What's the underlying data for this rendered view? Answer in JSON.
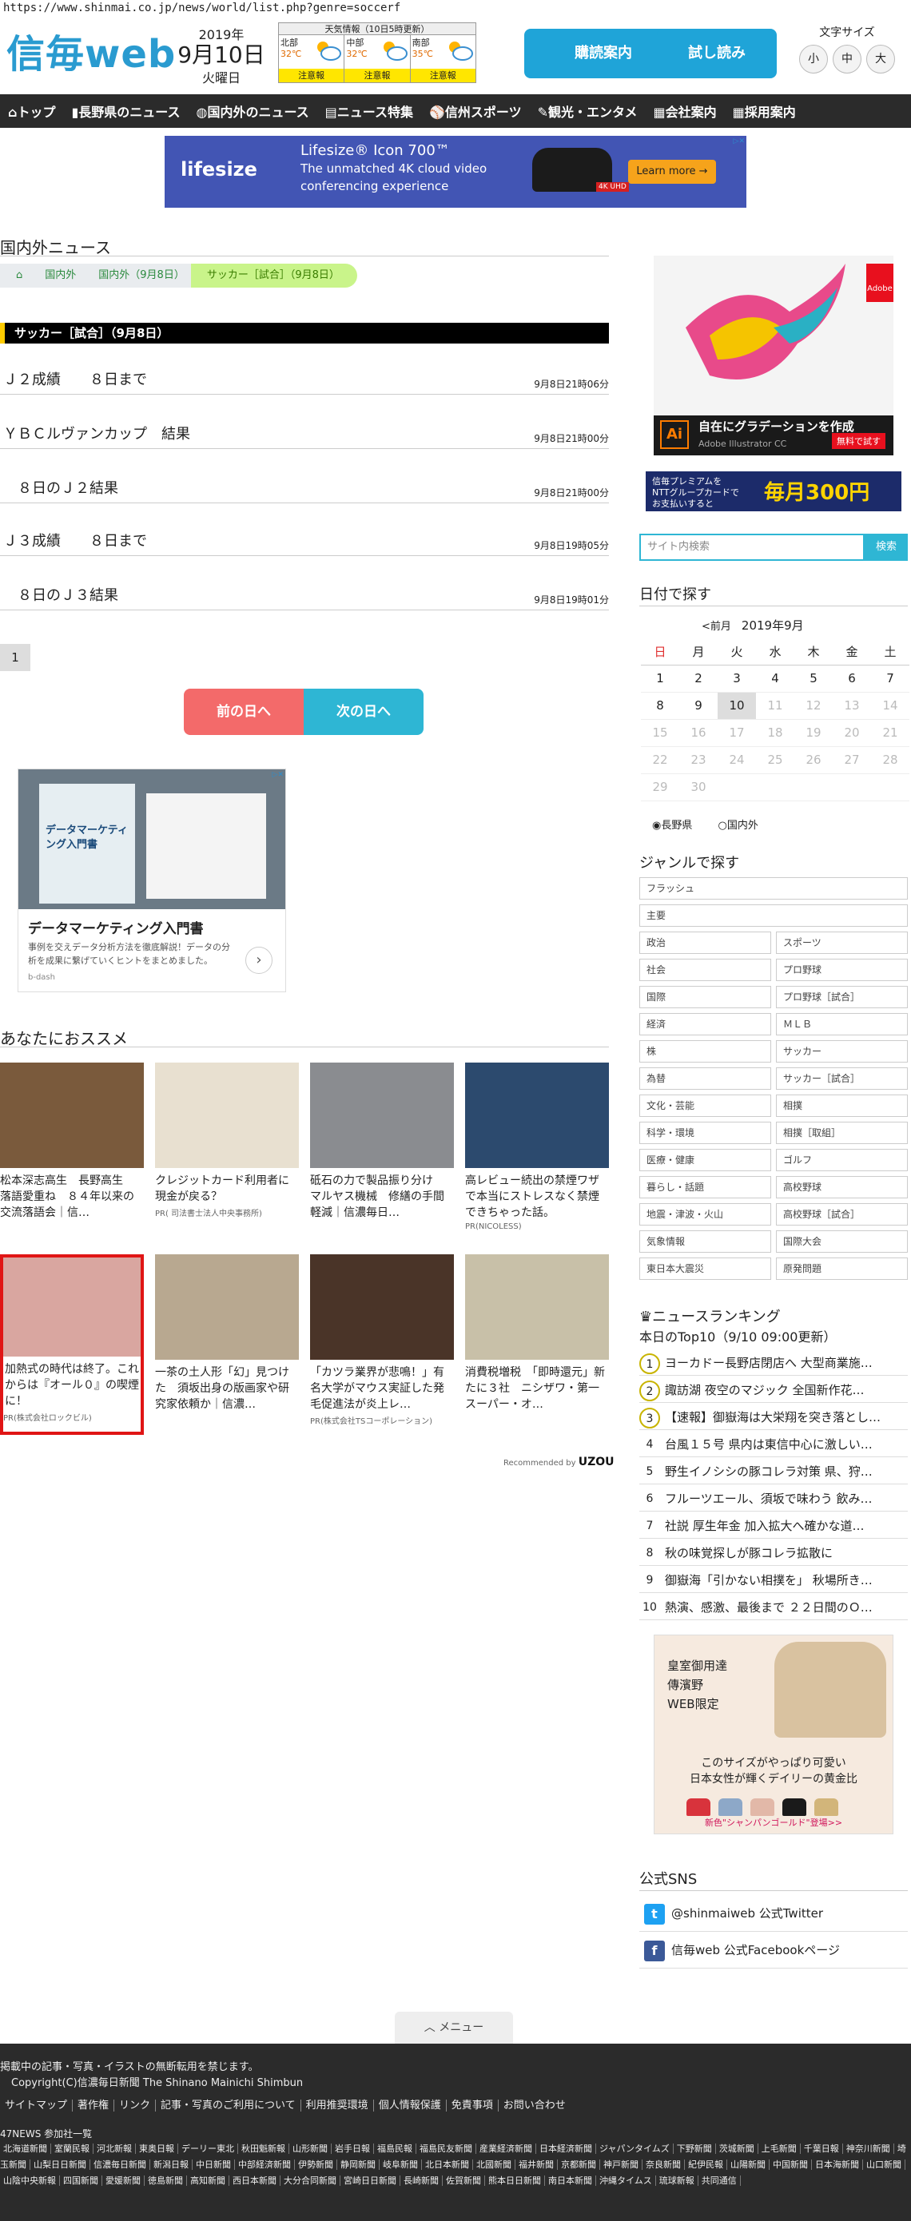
{
  "url": "https://www.shinmai.co.jp/news/world/list.php?genre=soccerf",
  "logo": "信毎web",
  "date": {
    "year": "2019年",
    "day": "9月10日",
    "weekday": "火曜日"
  },
  "weather": {
    "title": "天気情報（10日5時更新）",
    "regions": [
      {
        "name": "北部",
        "temp": "32℃",
        "warn": "注意報"
      },
      {
        "name": "中部",
        "temp": "32℃",
        "warn": "注意報"
      },
      {
        "name": "南部",
        "temp": "35℃",
        "warn": "注意報"
      }
    ]
  },
  "header_buttons": {
    "subscribe": "購読案内",
    "trial": "試し読み"
  },
  "font_size": {
    "label": "文字サイズ",
    "small": "小",
    "medium": "中",
    "large": "大"
  },
  "nav": [
    "トップ",
    "長野県のニュース",
    "国内外のニュース",
    "ニュース特集",
    "信州スポーツ",
    "観光・エンタメ",
    "会社案内",
    "採用案内"
  ],
  "top_ad": {
    "brand": "lifesize",
    "title": "Lifesize® Icon 700™",
    "line1": "The unmatched 4K cloud video",
    "line2": "conferencing experience",
    "badge": "4K UHD",
    "cta": "Learn more →"
  },
  "section_title": "国内外ニュース",
  "breadcrumb": [
    "国内外",
    "国内外（9月8日）",
    "サッカー［試合］（9月8日）"
  ],
  "category_header": "サッカー［試合］（9月8日）",
  "news": [
    {
      "title": "Ｊ２成績　　８日まで",
      "time": "9月8日21時06分"
    },
    {
      "title": "ＹＢＣルヴァンカップ　結果",
      "time": "9月8日21時00分"
    },
    {
      "title": "　８日のＪ２結果",
      "time": "9月8日21時00分"
    },
    {
      "title": "Ｊ３成績　　８日まで",
      "time": "9月8日19時05分"
    },
    {
      "title": "　８日のＪ３結果",
      "time": "9月8日19時01分"
    }
  ],
  "pagination": {
    "current": "1"
  },
  "day_nav": {
    "prev": "前の日へ",
    "next": "次の日へ"
  },
  "mid_ad": {
    "book1": "データマーケティング入門書",
    "title": "データマーケティング入門書",
    "desc": "事例を交えデータ分析方法を徹底解説！データの分析を成果に繋げていくヒントをまとめました。",
    "sponsor": "b-dash"
  },
  "recommend": {
    "title": "あなたにおススメ",
    "items": [
      {
        "text": "松本深志高生　長野高生　落語愛重ね　８４年以来の交流落語会｜信…",
        "pr": ""
      },
      {
        "text": "クレジットカード利用者に現金が戻る？",
        "pr": "PR( 司法書士法人中央事務所)"
      },
      {
        "text": "砥石の力で製品振り分け　マルヤス機械　修繕の手間軽減｜信濃毎日…",
        "pr": ""
      },
      {
        "text": "高レビュー続出の禁煙ワザで本当にストレスなく禁煙できちゃった話。",
        "pr": "PR(NICOLESS)"
      },
      {
        "text": "加熱式の時代は終了。これからは『オール０』の喫煙に！",
        "pr": "PR(株式会社ロックビル)"
      },
      {
        "text": "一茶の土人形「幻」見つけた　須坂出身の版画家や研究家依頼か｜信濃…",
        "pr": ""
      },
      {
        "text": "「カツラ業界が悲鳴！」有名大学がマウス実証した発毛促進法が炎上レ…",
        "pr": "PR(株式会社TSコーポレーション)"
      },
      {
        "text": "消費税増税　「即時還元」新たに３社　ニシザワ・第一スーパー・オ…",
        "pr": ""
      }
    ],
    "recommended_by": "Recommended by",
    "uzou": "UZOU"
  },
  "right_ad": {
    "logo": "Ai",
    "title": "自在にグラデーションを作成",
    "sub": "Adobe Illustrator CC",
    "cta": "無料で試す",
    "adobe": "Adobe"
  },
  "premium_banner": {
    "line1": "信毎プレミアムを",
    "line2": "NTTグループカードで",
    "line3": "お支払いすると",
    "amount": "毎月300円"
  },
  "search": {
    "placeholder": "サイト内検索",
    "button": "検索"
  },
  "calendar": {
    "title": "日付で探す",
    "prev": "<前月",
    "month": "2019年9月",
    "weekdays": [
      "日",
      "月",
      "火",
      "水",
      "木",
      "金",
      "土"
    ],
    "weeks": [
      [
        "1",
        "2",
        "3",
        "4",
        "5",
        "6",
        "7"
      ],
      [
        "8",
        "9",
        "10",
        "11",
        "12",
        "13",
        "14"
      ],
      [
        "15",
        "16",
        "17",
        "18",
        "19",
        "20",
        "21"
      ],
      [
        "22",
        "23",
        "24",
        "25",
        "26",
        "27",
        "28"
      ],
      [
        "29",
        "30",
        "",
        "",
        "",
        "",
        ""
      ]
    ],
    "today": "10",
    "region_options": [
      "長野県",
      "国内外"
    ]
  },
  "genre": {
    "title": "ジャンルで探す",
    "full": [
      "フラッシュ",
      "主要"
    ],
    "pairs": [
      [
        "政治",
        "スポーツ"
      ],
      [
        "社会",
        "プロ野球"
      ],
      [
        "国際",
        "プロ野球［試合］"
      ],
      [
        "経済",
        "ＭＬＢ"
      ],
      [
        "株",
        "サッカー"
      ],
      [
        "為替",
        "サッカー［試合］"
      ],
      [
        "文化・芸能",
        "相撲"
      ],
      [
        "科学・環境",
        "相撲［取組］"
      ],
      [
        "医療・健康",
        "ゴルフ"
      ],
      [
        "暮らし・話題",
        "高校野球"
      ],
      [
        "地震・津波・火山",
        "高校野球［試合］"
      ],
      [
        "気象情報",
        "国際大会"
      ],
      [
        "東日本大震災",
        "原発問題"
      ]
    ]
  },
  "ranking": {
    "title": "ニュースランキング",
    "subtitle": "本日のTop10（9/10 09:00更新）",
    "items": [
      "ヨーカドー長野店閉店へ 大型商業施…",
      "諏訪湖 夜空のマジック 全国新作花…",
      "【速報】御嶽海は大栄翔を突き落とし…",
      "台風１５号 県内は東信中心に激しい…",
      "野生イノシシの豚コレラ対策 県、狩…",
      "フルーツエール、須坂で味わう 飲み…",
      "社説 厚生年金 加入拡大へ確かな道…",
      "秋の味覚探しが豚コレラ拡散に",
      "御嶽海「引かない相撲を」 秋場所き…",
      "熱演、感激、最後まで ２２日間のＯ…"
    ]
  },
  "bag_ad": {
    "l1": "皇室御用達",
    "l2": "傳濱野",
    "l3": "WEB限定",
    "mid1": "このサイズがやっぱり可愛い",
    "mid2": "日本女性が輝くデイリーの黄金比",
    "foot": "新色\"シャンパンゴールド\"登場>>"
  },
  "sns": {
    "title": "公式SNS",
    "twitter": "@shinmaiweb 公式Twitter",
    "facebook": "信毎web 公式Facebookページ"
  },
  "menu_tab": "メニュー",
  "footer": {
    "notice": "掲載中の記事・写真・イラストの無断転用を禁じます。",
    "copyright": "Copyright(C)信濃毎日新聞 The Shinano Mainichi Shimbun",
    "links": [
      "サイトマップ",
      "著作権",
      "リンク",
      "記事・写真のご利用について",
      "利用推奨環境",
      "個人情報保護",
      "免責事項",
      "お問い合わせ"
    ],
    "news47": "47NEWS 参加社一覧",
    "papers": [
      "北海道新聞",
      "室蘭民報",
      "河北新報",
      "東奥日報",
      "デーリー東北",
      "秋田魁新報",
      "山形新聞",
      "岩手日報",
      "福島民報",
      "福島民友新聞",
      "産業経済新聞",
      "日本経済新聞",
      "ジャパンタイムズ",
      "下野新聞",
      "茨城新聞",
      "上毛新聞",
      "千葉日報",
      "神奈川新聞",
      "埼玉新聞",
      "山梨日日新聞",
      "信濃毎日新聞",
      "新潟日報",
      "中日新聞",
      "中部経済新聞",
      "伊勢新聞",
      "静岡新聞",
      "岐阜新聞",
      "北日本新聞",
      "北國新聞",
      "福井新聞",
      "京都新聞",
      "神戸新聞",
      "奈良新聞",
      "紀伊民報",
      "山陽新聞",
      "中国新聞",
      "日本海新聞",
      "山口新聞",
      "山陰中央新報",
      "四国新聞",
      "愛媛新聞",
      "徳島新聞",
      "高知新聞",
      "西日本新聞",
      "大分合同新聞",
      "宮崎日日新聞",
      "長崎新聞",
      "佐賀新聞",
      "熊本日日新聞",
      "南日本新聞",
      "沖縄タイムス",
      "琉球新報",
      "共同通信"
    ]
  }
}
